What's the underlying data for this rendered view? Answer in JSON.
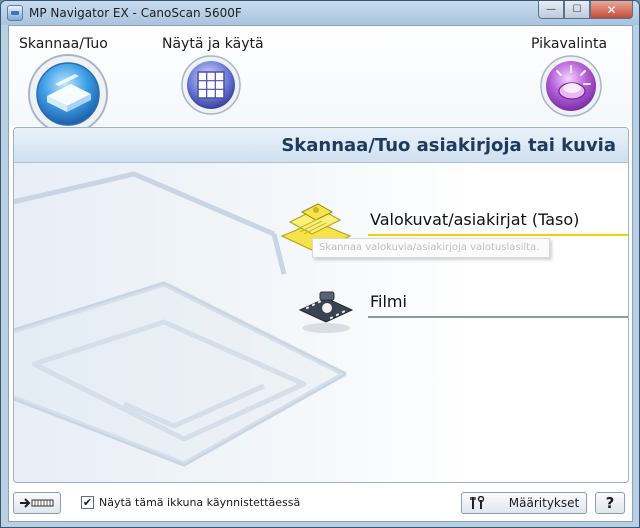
{
  "window": {
    "title": "MP Navigator EX - CanoScan 5600F",
    "minimize_glyph": "—",
    "maximize_glyph": "☐",
    "close_glyph": "✕"
  },
  "modes": [
    {
      "label": "Skannaa/Tuo",
      "icon": "scanner-icon",
      "selected": true
    },
    {
      "label": "Näytä ja käytä",
      "icon": "grid-view-icon",
      "selected": false
    },
    {
      "label": "Pikavalinta",
      "icon": "one-click-icon",
      "selected": false
    }
  ],
  "panel": {
    "title": "Skannaa/Tuo asiakirjoja tai kuvia"
  },
  "options": [
    {
      "label": "Valokuvat/asiakirjat (Taso)",
      "icon": "photo-document-icon",
      "highlighted": true,
      "tooltip": "Skannaa valokuvia/asiakirjoja valotuslasilta."
    },
    {
      "label": "Filmi",
      "icon": "film-icon",
      "highlighted": false
    }
  ],
  "bottom": {
    "startup_checkbox_label": "Näytä tämä ikkuna käynnistettäessä",
    "startup_checkbox_checked": true,
    "check_glyph": "✔",
    "settings_label": "Määritykset",
    "help_label": "?"
  },
  "colors": {
    "accent_blue": "#3d8fd6",
    "highlight_yellow": "#e8d800",
    "film_line": "#8a98a8",
    "purple": "#a24fc6"
  }
}
